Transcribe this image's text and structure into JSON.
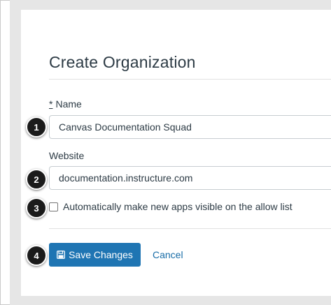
{
  "form": {
    "title": "Create Organization",
    "name_required_mark": "*",
    "name_label": "Name",
    "name_value": "Canvas Documentation Squad",
    "website_label": "Website",
    "website_value": "documentation.instructure.com",
    "allow_list_checkbox_label": "Automatically make new apps visible on the allow list",
    "allow_list_checked": false,
    "save_label": "Save Changes",
    "cancel_label": "Cancel"
  },
  "steps": [
    "1",
    "2",
    "3",
    "4"
  ],
  "colors": {
    "primary_button": "#1f75b3",
    "link": "#1a6ea8",
    "text": "#2d3b45",
    "step_marker": "#1b1b1b"
  },
  "icons": {
    "save_button_icon": "floppy-disk-icon"
  }
}
